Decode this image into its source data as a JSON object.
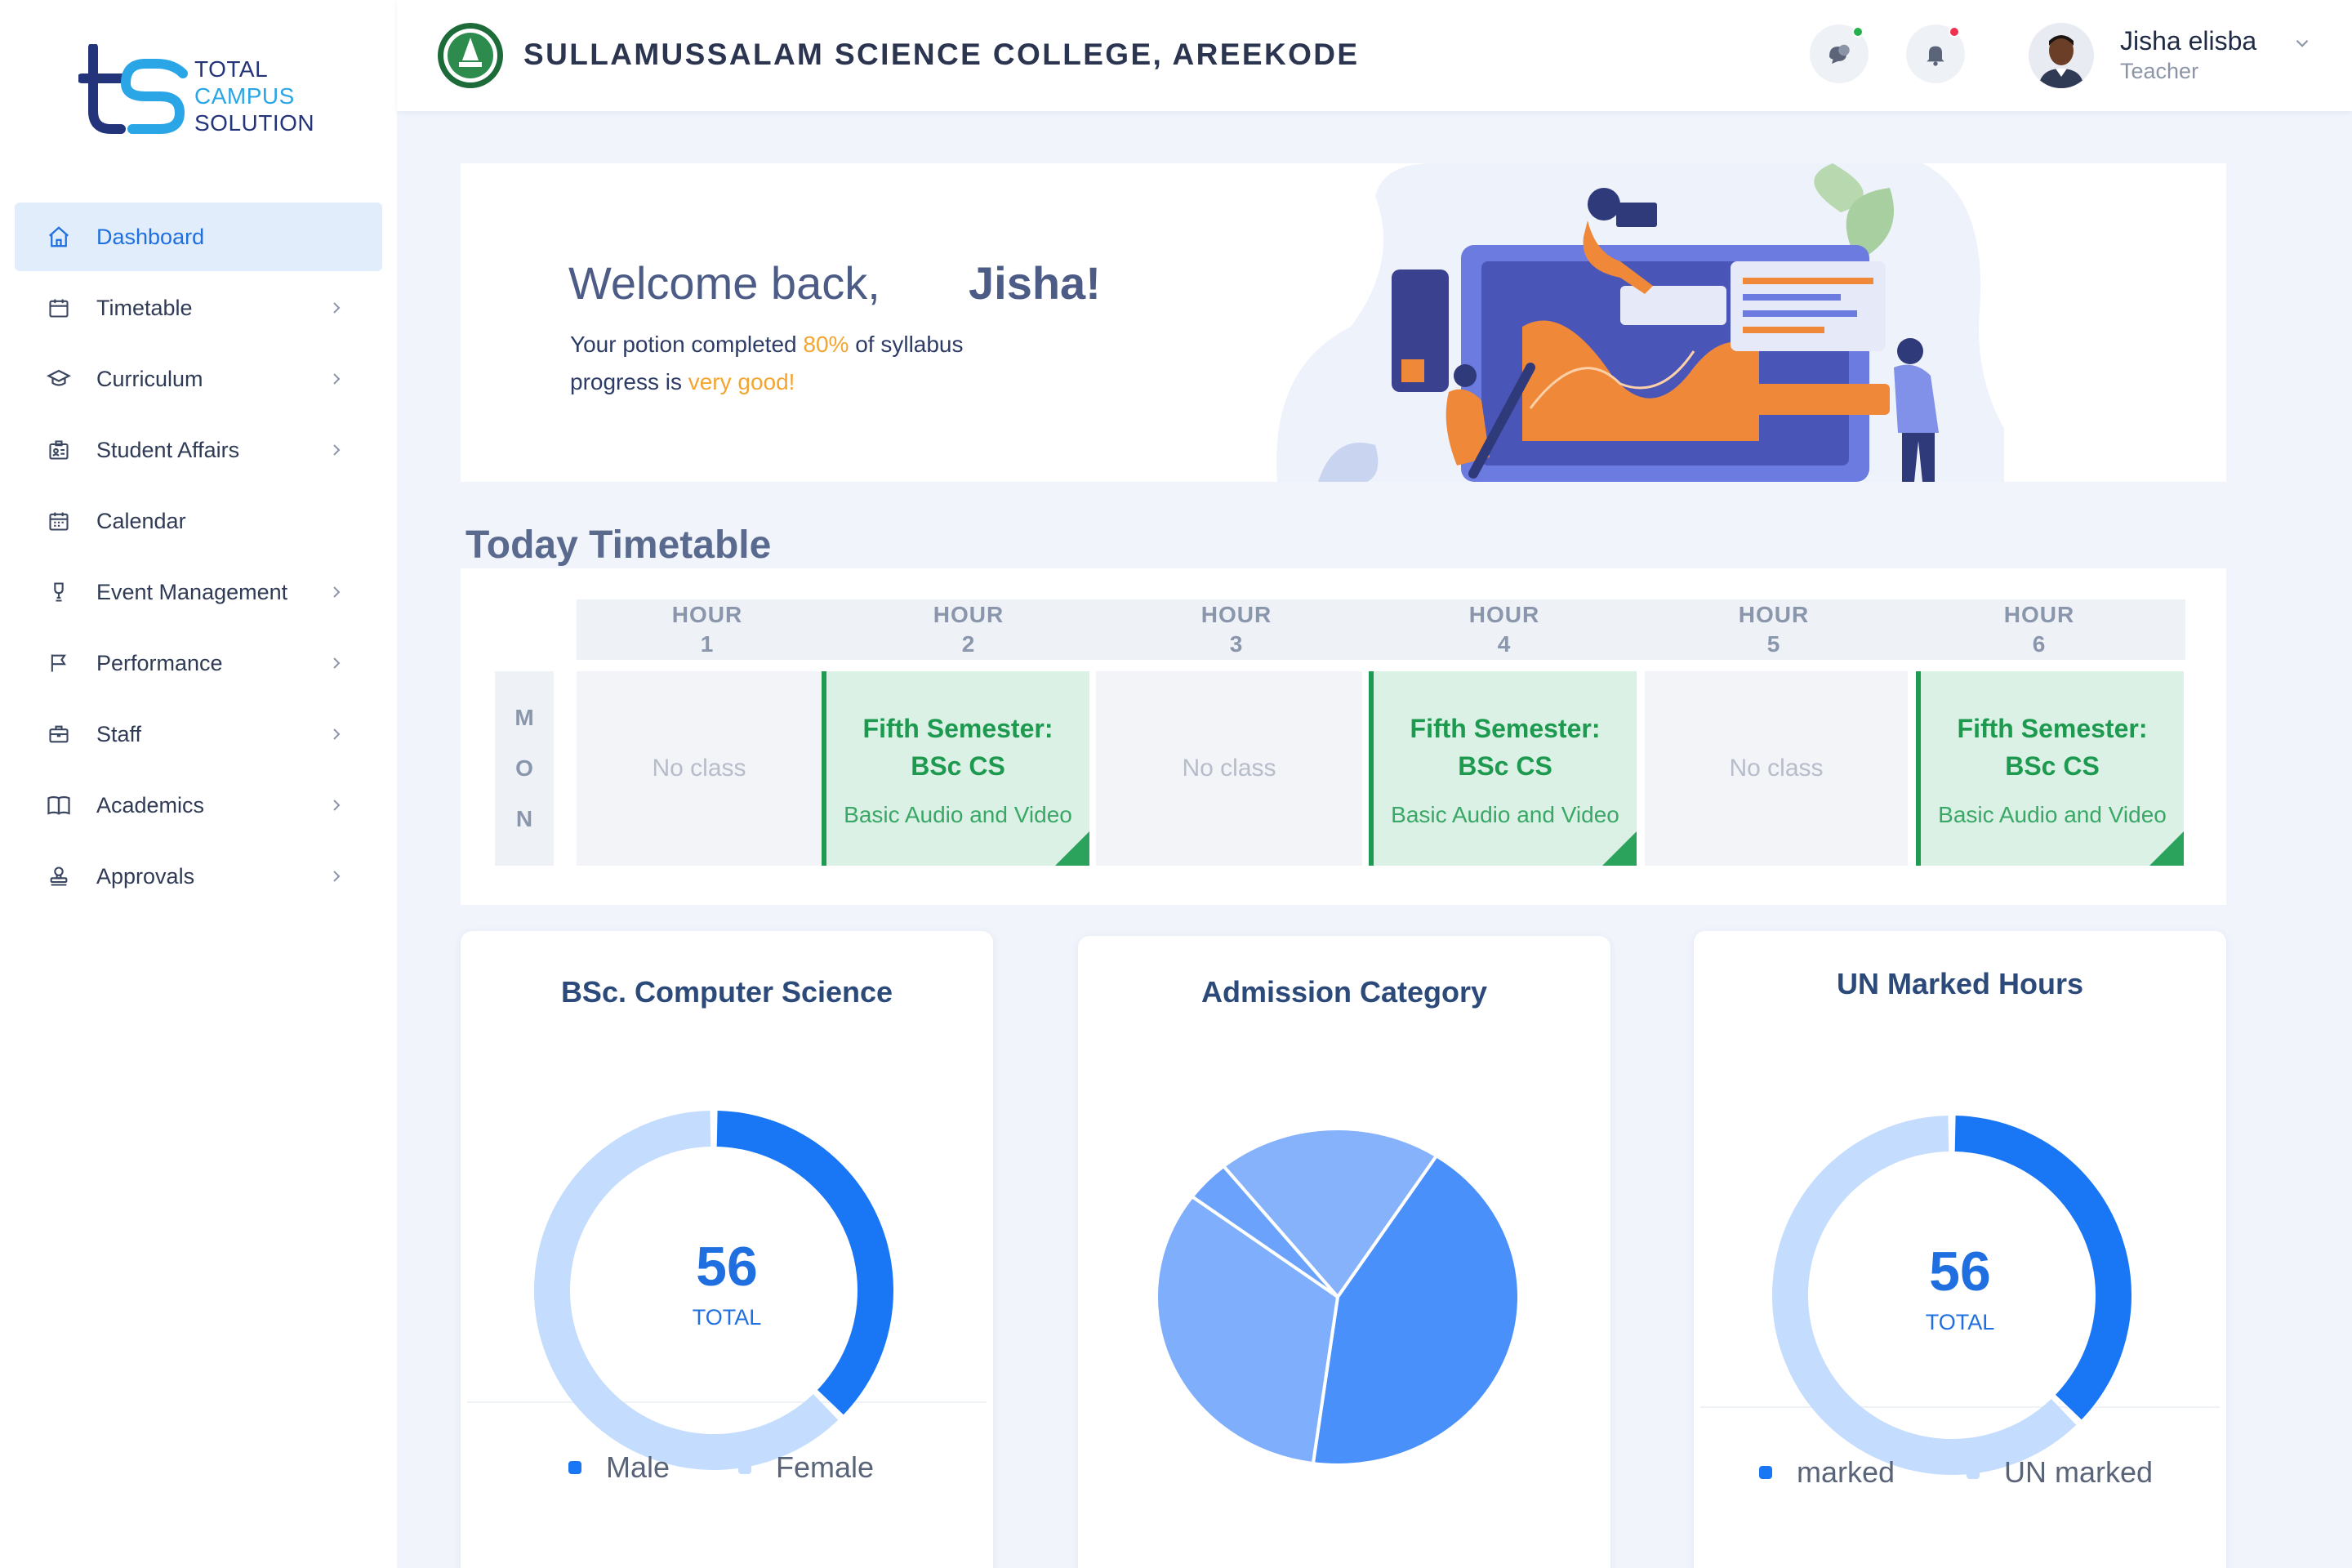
{
  "brand": {
    "line1": "TOTAL",
    "line2": "CAMPUS",
    "line3": "SOLUTION"
  },
  "sidebar": {
    "items": [
      {
        "label": "Dashboard",
        "icon": "home-icon",
        "active": true,
        "has_children": false
      },
      {
        "label": "Timetable",
        "icon": "calendar-icon",
        "active": false,
        "has_children": true
      },
      {
        "label": "Curriculum",
        "icon": "graduation-cap-icon",
        "active": false,
        "has_children": true
      },
      {
        "label": "Student Affairs",
        "icon": "id-card-icon",
        "active": false,
        "has_children": true
      },
      {
        "label": "Calendar",
        "icon": "calendar-grid-icon",
        "active": false,
        "has_children": false
      },
      {
        "label": "Event Management",
        "icon": "trophy-icon",
        "active": false,
        "has_children": true
      },
      {
        "label": "Performance",
        "icon": "flag-icon",
        "active": false,
        "has_children": true
      },
      {
        "label": "Staff",
        "icon": "briefcase-icon",
        "active": false,
        "has_children": true
      },
      {
        "label": "Academics",
        "icon": "book-icon",
        "active": false,
        "has_children": true
      },
      {
        "label": "Approvals",
        "icon": "stamp-icon",
        "active": false,
        "has_children": true
      }
    ]
  },
  "header": {
    "college_name": "SULLAMUSSALAM SCIENCE COLLEGE, AREEKODE",
    "user": {
      "name": "Jisha elisba",
      "role": "Teacher"
    },
    "chat_status_color": "#22b14c",
    "notif_status_color": "#f0304f"
  },
  "welcome": {
    "greeting": "Welcome back,",
    "name": "Jisha!",
    "line1_pre": "Your potion completed",
    "line1_value": "80%",
    "line1_post": "of syllabus",
    "line2_pre": "progress is",
    "line2_value": "very good!"
  },
  "timetable": {
    "title": "Today  Timetable",
    "day_letters": [
      "M",
      "O",
      "N"
    ],
    "hours": [
      {
        "label": "HOUR",
        "number": "1"
      },
      {
        "label": "HOUR",
        "number": "2"
      },
      {
        "label": "HOUR",
        "number": "3"
      },
      {
        "label": "HOUR",
        "number": "4"
      },
      {
        "label": "HOUR",
        "number": "5"
      },
      {
        "label": "HOUR",
        "number": "6"
      }
    ],
    "cells": [
      {
        "type": "empty",
        "text": "No class"
      },
      {
        "type": "class",
        "semester": "Fifth Semester:",
        "course": "BSc CS",
        "subject": "Basic Audio and Video"
      },
      {
        "type": "empty",
        "text": "No class"
      },
      {
        "type": "class",
        "semester": "Fifth Semester:",
        "course": "BSc CS",
        "subject": "Basic Audio and Video"
      },
      {
        "type": "empty",
        "text": "No class"
      },
      {
        "type": "class",
        "semester": "Fifth Semester:",
        "course": "BSc CS",
        "subject": "Basic Audio and Video"
      }
    ]
  },
  "chart_data": [
    {
      "type": "pie",
      "title": "BSc. Computer Science",
      "style": "donut",
      "center_value": "56",
      "center_label": "TOTAL",
      "categories": [
        "Male",
        "Female"
      ],
      "values": [
        21,
        35
      ],
      "colors": [
        "#1976f5",
        "#c4dcfd"
      ]
    },
    {
      "type": "pie",
      "title": "Admission Category",
      "categories": [
        "",
        "",
        "",
        ""
      ],
      "values": [
        43,
        33,
        4,
        20
      ],
      "colors": [
        "#4a90fb",
        "#7faefc",
        "#6ba2fb",
        "#86b2fb"
      ]
    },
    {
      "type": "pie",
      "title": "UN Marked Hours",
      "style": "donut",
      "center_value": "56",
      "center_label": "TOTAL",
      "categories": [
        "marked",
        "UN marked"
      ],
      "values": [
        21,
        35
      ],
      "colors": [
        "#1976f5",
        "#c4dcfd"
      ]
    }
  ]
}
